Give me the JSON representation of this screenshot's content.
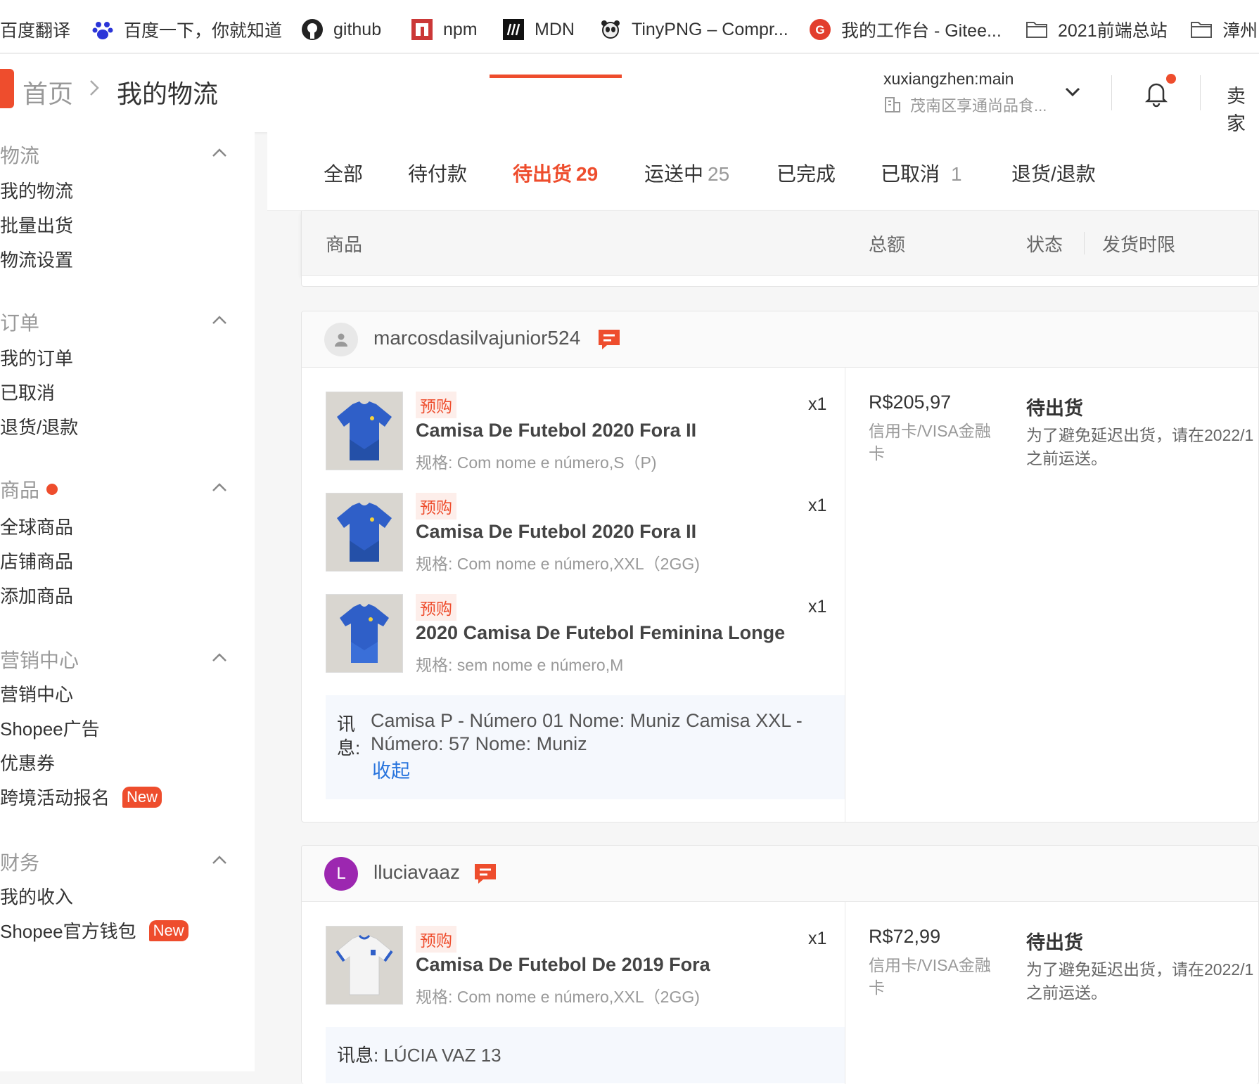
{
  "bookmarks": [
    {
      "label": "百度翻译"
    },
    {
      "label": "百度一下，你就知道"
    },
    {
      "label": "github"
    },
    {
      "label": "npm"
    },
    {
      "label": "MDN"
    },
    {
      "label": "TinyPNG – Compr..."
    },
    {
      "label": "我的工作台 - Gitee..."
    },
    {
      "label": "2021前端总站"
    },
    {
      "label": "漳州"
    }
  ],
  "header": {
    "home": "首页",
    "current": "我的物流",
    "account_name": "xuxiangzhen:main",
    "shop_name": "茂南区享通尚品食...",
    "seller": "卖家"
  },
  "sidebar": {
    "sections": [
      {
        "title": "物流",
        "items": [
          "我的物流",
          "批量出货",
          "物流设置"
        ]
      },
      {
        "title": "订单",
        "items": [
          "我的订单",
          "已取消",
          "退货/退款"
        ]
      },
      {
        "title": "商品",
        "items": [
          "全球商品",
          "店铺商品",
          "添加商品"
        ]
      },
      {
        "title": "营销中心",
        "items": [
          "营销中心",
          "Shopee广告",
          "优惠券",
          "跨境活动报名"
        ]
      },
      {
        "title": "财务",
        "items": [
          "我的收入",
          "Shopee官方钱包"
        ]
      }
    ],
    "new_badge": "New"
  },
  "tabs": [
    {
      "label": "全部",
      "count": ""
    },
    {
      "label": "待付款",
      "count": ""
    },
    {
      "label": "待出货",
      "count": "29"
    },
    {
      "label": "运送中",
      "count": "25"
    },
    {
      "label": "已完成",
      "count": ""
    },
    {
      "label": "已取消",
      "count": "1"
    },
    {
      "label": "退货/退款",
      "count": ""
    }
  ],
  "table_head": {
    "product": "商品",
    "total": "总额",
    "status": "状态",
    "deadline": "发货时限"
  },
  "orders": [
    {
      "buyer": "marcosdasilvajunior524",
      "avatar_letter": "",
      "items": [
        {
          "tag": "预购",
          "name": "Camisa De Futebol 2020 Fora II",
          "spec": "规格: Com nome e número,S（P)",
          "qty": "x1"
        },
        {
          "tag": "预购",
          "name": "Camisa De Futebol 2020 Fora II",
          "spec": "规格: Com nome e número,XXL（2GG)",
          "qty": "x1"
        },
        {
          "tag": "预购",
          "name": "2020 Camisa De Futebol Feminina Longe",
          "spec": "规格: sem nome e número,M",
          "qty": "x1"
        }
      ],
      "total": "R$205,97",
      "payment": "信用卡/VISA金融卡",
      "status": "待出货",
      "status_note": "为了避免延迟出货，请在2022/1之前运送。",
      "message_label": "讯息:",
      "message": "Camisa P - Número 01 Nome: Muniz Camisa XXL - Número: 57 Nome: Muniz",
      "collapse": "收起"
    },
    {
      "buyer": "lluciavaaz",
      "avatar_letter": "L",
      "items": [
        {
          "tag": "预购",
          "name": "Camisa De Futebol De 2019 Fora",
          "spec": "规格: Com nome e número,XXL（2GG)",
          "qty": "x1"
        }
      ],
      "total": "R$72,99",
      "payment": "信用卡/VISA金融卡",
      "status": "待出货",
      "status_note": "为了避免延迟出货，请在2022/1之前运送。",
      "message_label": "讯息:",
      "message": "LÚCIA VAZ 13"
    }
  ],
  "colors": {
    "accent": "#ee4d2d",
    "link": "#2673dd",
    "jersey_blue": "#2f5fc8",
    "jersey_white": "#f4f4f4"
  }
}
